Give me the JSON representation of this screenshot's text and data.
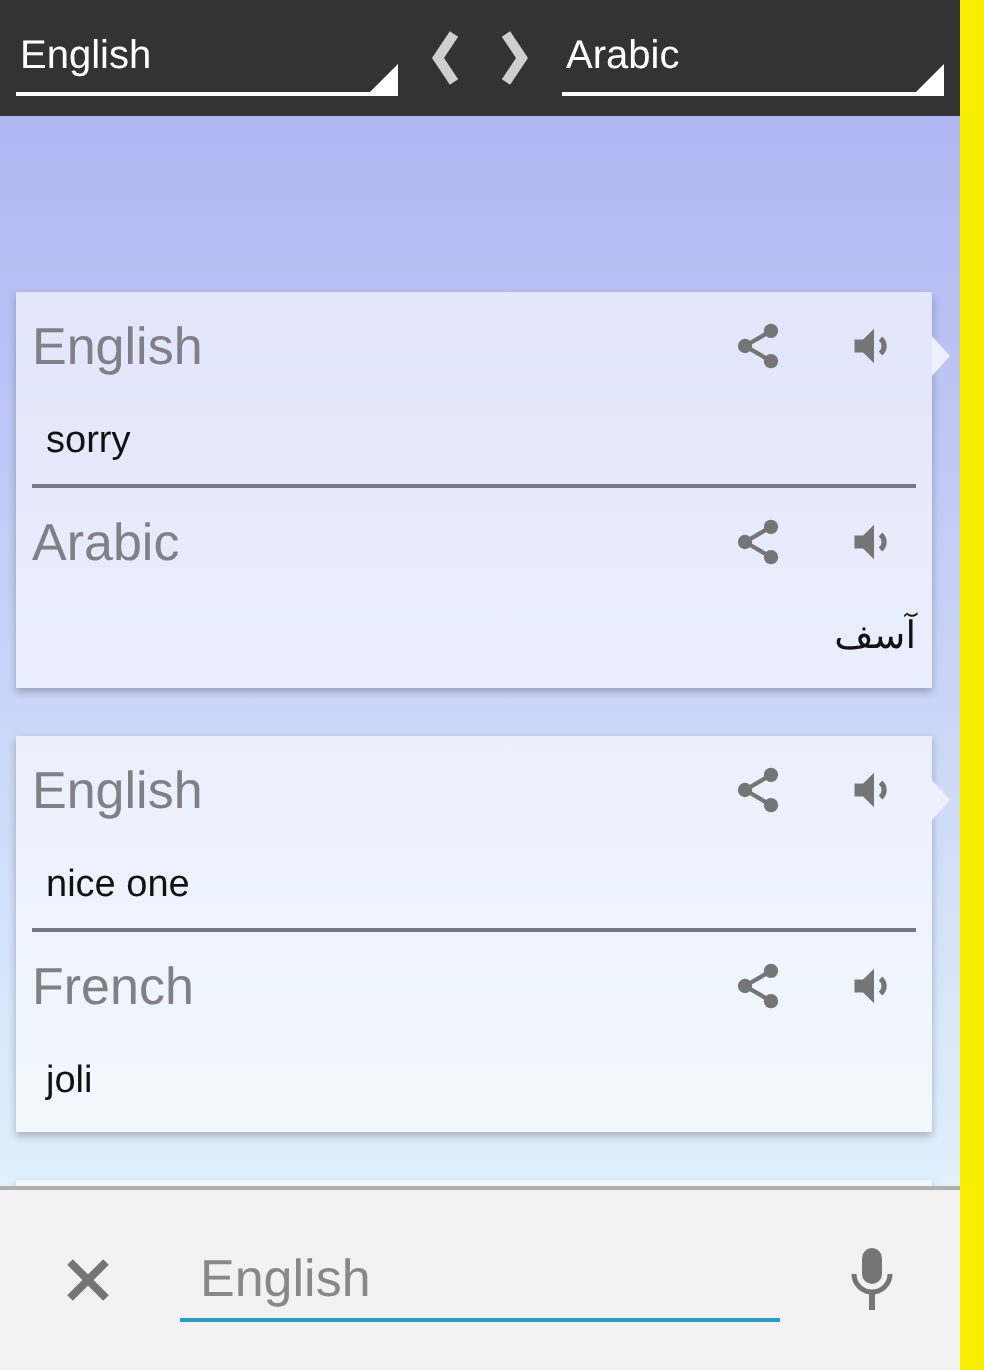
{
  "toolbar": {
    "source_language": "English",
    "target_language": "Arabic"
  },
  "cards": [
    {
      "source": {
        "language": "English",
        "text": "sorry"
      },
      "target": {
        "language": "Arabic",
        "text": "آسف"
      }
    },
    {
      "source": {
        "language": "English",
        "text": "nice one"
      },
      "target": {
        "language": "French",
        "text": "joli"
      }
    }
  ],
  "input": {
    "placeholder": "English"
  }
}
